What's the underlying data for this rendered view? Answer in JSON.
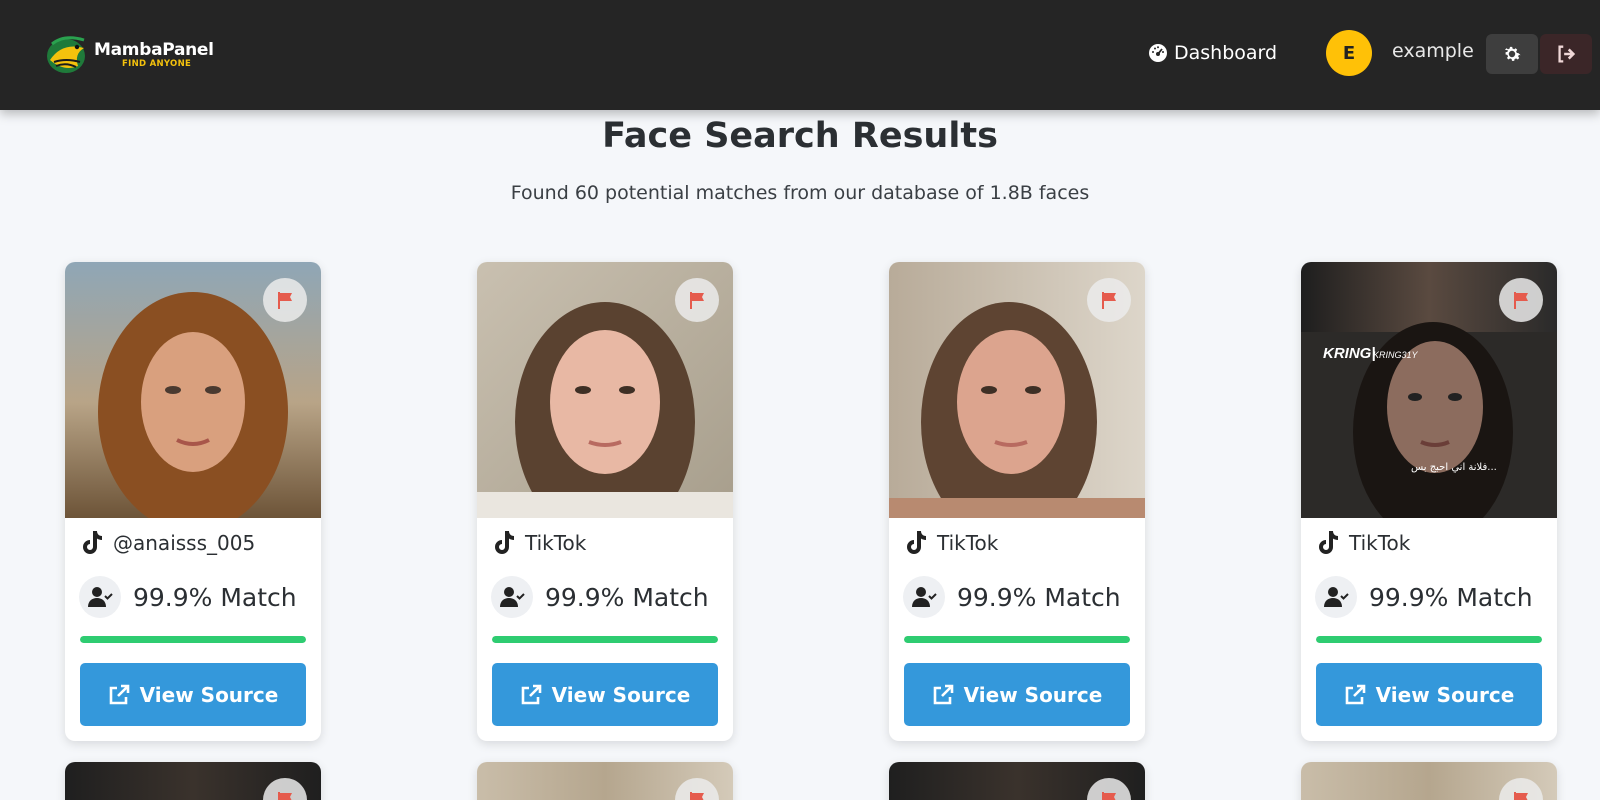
{
  "header": {
    "logo_title": "MambaPanel",
    "logo_subtitle": "FIND ANYONE",
    "nav_dashboard": "Dashboard",
    "avatar_initial": "E",
    "user_name": "example",
    "icons": [
      "dashboard-gauge-icon",
      "gear-icon",
      "sign-out-icon"
    ]
  },
  "page": {
    "title": "Face Search Results",
    "subtitle": "Found 60 potential matches from our database of 1.8B faces"
  },
  "results": [
    {
      "source": "@anaisss_005",
      "source_icon": "tiktok-icon",
      "match": "99.9% Match",
      "match_fraction": 1.0,
      "button": "View Source"
    },
    {
      "source": "TikTok",
      "source_icon": "tiktok-icon",
      "match": "99.9% Match",
      "match_fraction": 1.0,
      "button": "View Source"
    },
    {
      "source": "TikTok",
      "source_icon": "tiktok-icon",
      "match": "99.9% Match",
      "match_fraction": 1.0,
      "button": "View Source"
    },
    {
      "source": "TikTok",
      "source_icon": "tiktok-icon",
      "match": "99.9% Match",
      "match_fraction": 1.0,
      "button": "View Source"
    }
  ],
  "photo_overlays": {
    "card4_brand": "KRING|",
    "card4_handle": "KRING31Y",
    "card4_caption": "فلانة اني احبج بس..."
  },
  "colors": {
    "header_bg": "#252525",
    "accent_button": "#3498db",
    "match_bar": "#2ecc71",
    "flag": "#e55b4d",
    "avatar": "#ffc107"
  }
}
